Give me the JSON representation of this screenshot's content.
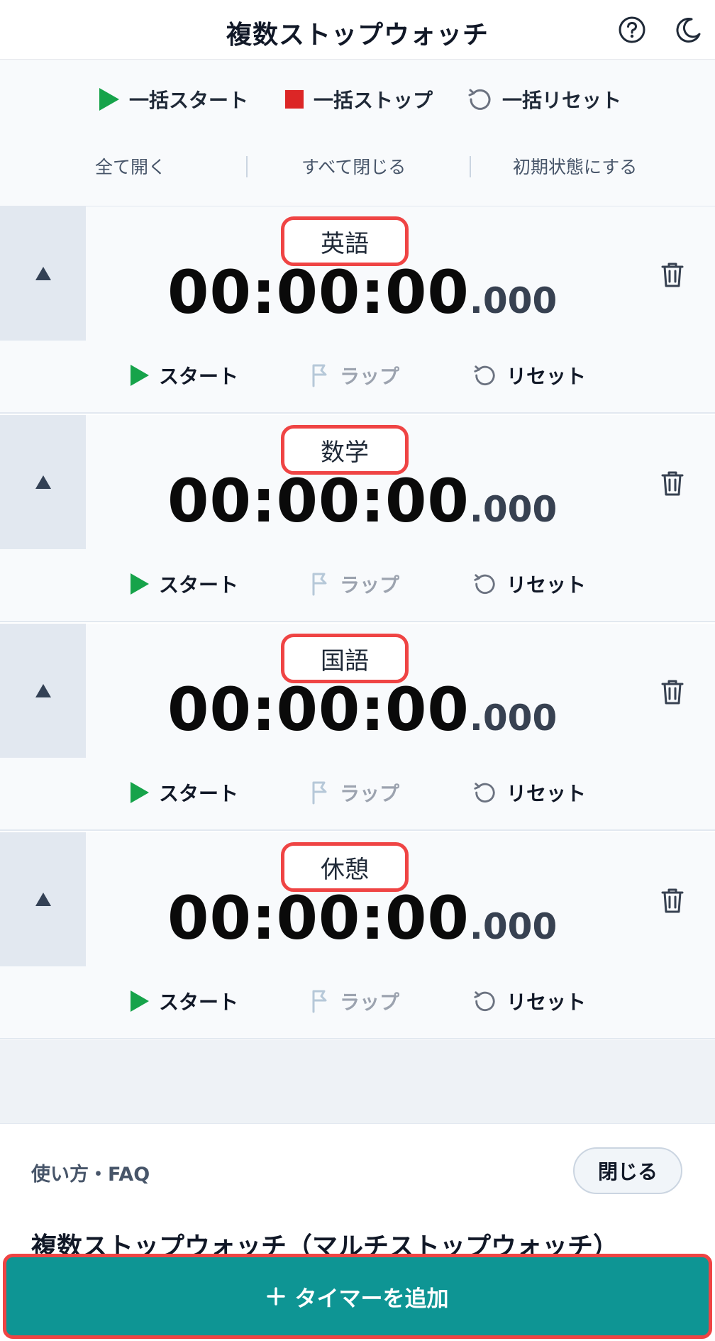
{
  "header": {
    "title": "複数ストップウォッチ"
  },
  "bulk_controls": {
    "start_all": "一括スタート",
    "stop_all": "一括ストップ",
    "reset_all": "一括リセット"
  },
  "view_controls": {
    "open_all": "全て開く",
    "close_all": "すべて閉じる",
    "initialize": "初期状態にする"
  },
  "timers": [
    {
      "name": "英語",
      "time": "00:00:00",
      "ms": ".000"
    },
    {
      "name": "数学",
      "time": "00:00:00",
      "ms": ".000"
    },
    {
      "name": "国語",
      "time": "00:00:00",
      "ms": ".000"
    },
    {
      "name": "休憩",
      "time": "00:00:00",
      "ms": ".000"
    }
  ],
  "timer_buttons": {
    "start": "スタート",
    "lap": "ラップ",
    "reset": "リセット"
  },
  "faq": {
    "label": "使い方・FAQ",
    "close": "閉じる",
    "article_title": "複数ストップウォッチ（マルチストップウォッチ）"
  },
  "add_timer": {
    "label": "タイマーを追加"
  },
  "colors": {
    "start": "#16a34a",
    "stop": "#dc2626",
    "accent": "#0e9594",
    "highlight": "#ef4444"
  },
  "icons": [
    "help-icon",
    "moon-icon",
    "play-icon",
    "stop-icon",
    "reset-icon",
    "flag-icon",
    "trash-icon",
    "collapse-icon",
    "plus-icon"
  ]
}
